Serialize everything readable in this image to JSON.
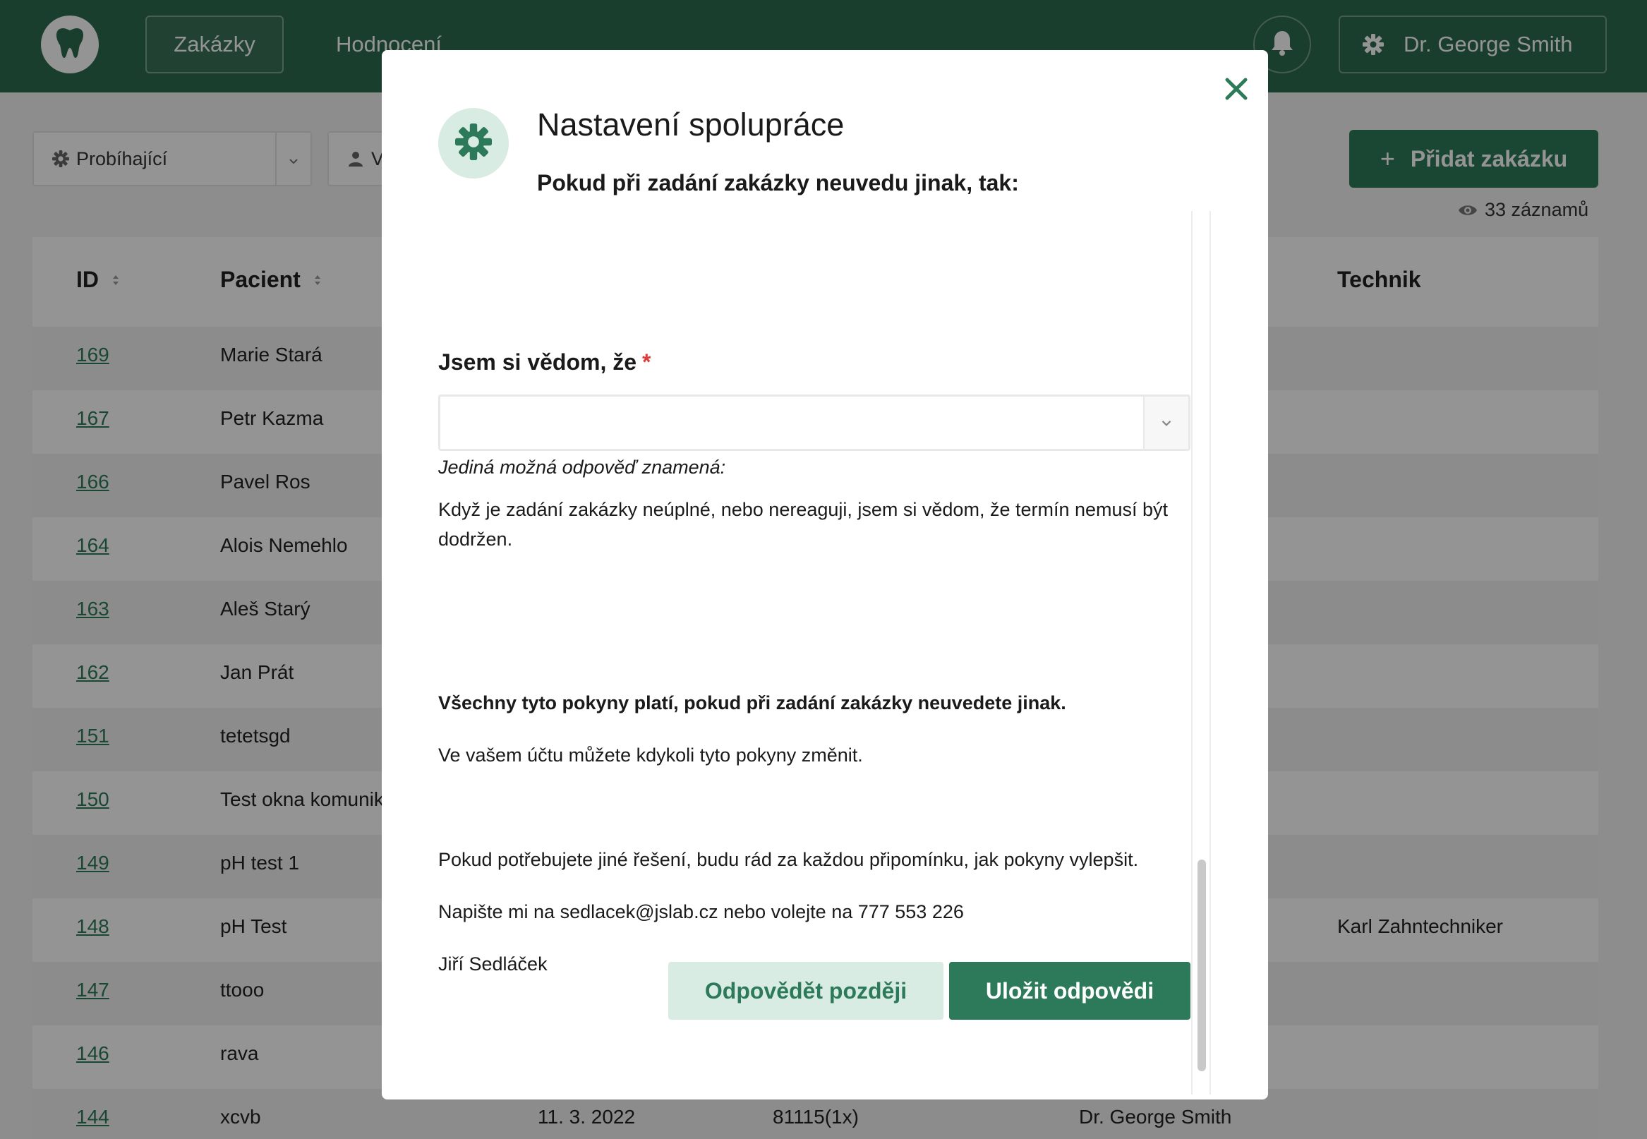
{
  "colors": {
    "brand_green": "#2d7a5a",
    "header_green": "#2d6b4f",
    "light_green": "#d9ece3",
    "required_red": "#e03a3a"
  },
  "header": {
    "logo_icon": "tooth-icon",
    "nav": [
      {
        "label": "Zakázky",
        "active": true
      },
      {
        "label": "Hodnocení",
        "active": false
      }
    ],
    "bell_icon": "bell-icon",
    "user": {
      "icon": "gear-icon",
      "name": "Dr. George Smith"
    }
  },
  "filters": {
    "status": {
      "icon": "gear-icon",
      "value": "Probíhající"
    },
    "person": {
      "icon": "person-icon",
      "value": "V"
    }
  },
  "actions": {
    "add_order": "Přidat zakázku",
    "records_count": "33 záznamů"
  },
  "table": {
    "columns": {
      "id": "ID",
      "patient": "Pacient",
      "technician": "Technik"
    },
    "rows": [
      {
        "id": "169",
        "patient": "Marie Stará",
        "date": "",
        "items": "",
        "doctor": "",
        "technician": ""
      },
      {
        "id": "167",
        "patient": "Petr Kazma",
        "date": "",
        "items": "",
        "doctor": "",
        "technician": ""
      },
      {
        "id": "166",
        "patient": "Pavel Ros",
        "date": "",
        "items": "",
        "doctor": "",
        "technician": ""
      },
      {
        "id": "164",
        "patient": "Alois Nemehlo",
        "date": "",
        "items": "",
        "doctor": "",
        "technician": ""
      },
      {
        "id": "163",
        "patient": "Aleš Starý",
        "date": "",
        "items": "",
        "doctor": "",
        "technician": ""
      },
      {
        "id": "162",
        "patient": "Jan Prát",
        "date": "",
        "items": "",
        "doctor": "",
        "technician": ""
      },
      {
        "id": "151",
        "patient": "tetetsgd",
        "date": "",
        "items": "",
        "doctor": "",
        "technician": ""
      },
      {
        "id": "150",
        "patient": "Test okna komunik",
        "date": "",
        "items": "",
        "doctor": "",
        "technician": ""
      },
      {
        "id": "149",
        "patient": "pH test 1",
        "date": "",
        "items": "",
        "doctor": "",
        "technician": ""
      },
      {
        "id": "148",
        "patient": "pH Test",
        "date": "",
        "items": "",
        "doctor": "",
        "technician": "Karl Zahntechniker"
      },
      {
        "id": "147",
        "patient": "ttooo",
        "date": "",
        "items": "",
        "doctor": "",
        "technician": ""
      },
      {
        "id": "146",
        "patient": "rava",
        "date": "",
        "items": "",
        "doctor": "",
        "technician": ""
      },
      {
        "id": "144",
        "patient": "xcvb",
        "date": "11. 3. 2022",
        "items": "81115(1x)",
        "doctor": "Dr. George Smith",
        "technician": ""
      }
    ]
  },
  "modal": {
    "icon": "gear-icon",
    "title": "Nastavení spolupráce",
    "subtitle": "Pokud při zadání zakázky neuvedu jinak, tak:",
    "question_label": "Jsem si vědom, že",
    "required_mark": "*",
    "select_value": "",
    "hint": "Jediná možná odpověď znamená:",
    "answer_text": "Když je zadání zakázky neúplné, nebo nereaguji, jsem si vědom, že termín nemusí být dodržen.",
    "note_bold": "Všechny tyto pokyny platí, pokud při zadání zakázky neuvedete jinak.",
    "note_change": "Ve vašem účtu můžete kdykoli tyto pokyny změnit.",
    "feedback": "Pokud potřebujete jiné řešení, budu rád za každou připomínku, jak pokyny vylepšit.",
    "contact": "Napište mi na sedlacek@jslab.cz nebo volejte na 777 553 226",
    "signature": "Jiří Sedláček",
    "btn_later": "Odpovědět později",
    "btn_save": "Uložit odpovědi",
    "close_icon": "close-icon"
  }
}
